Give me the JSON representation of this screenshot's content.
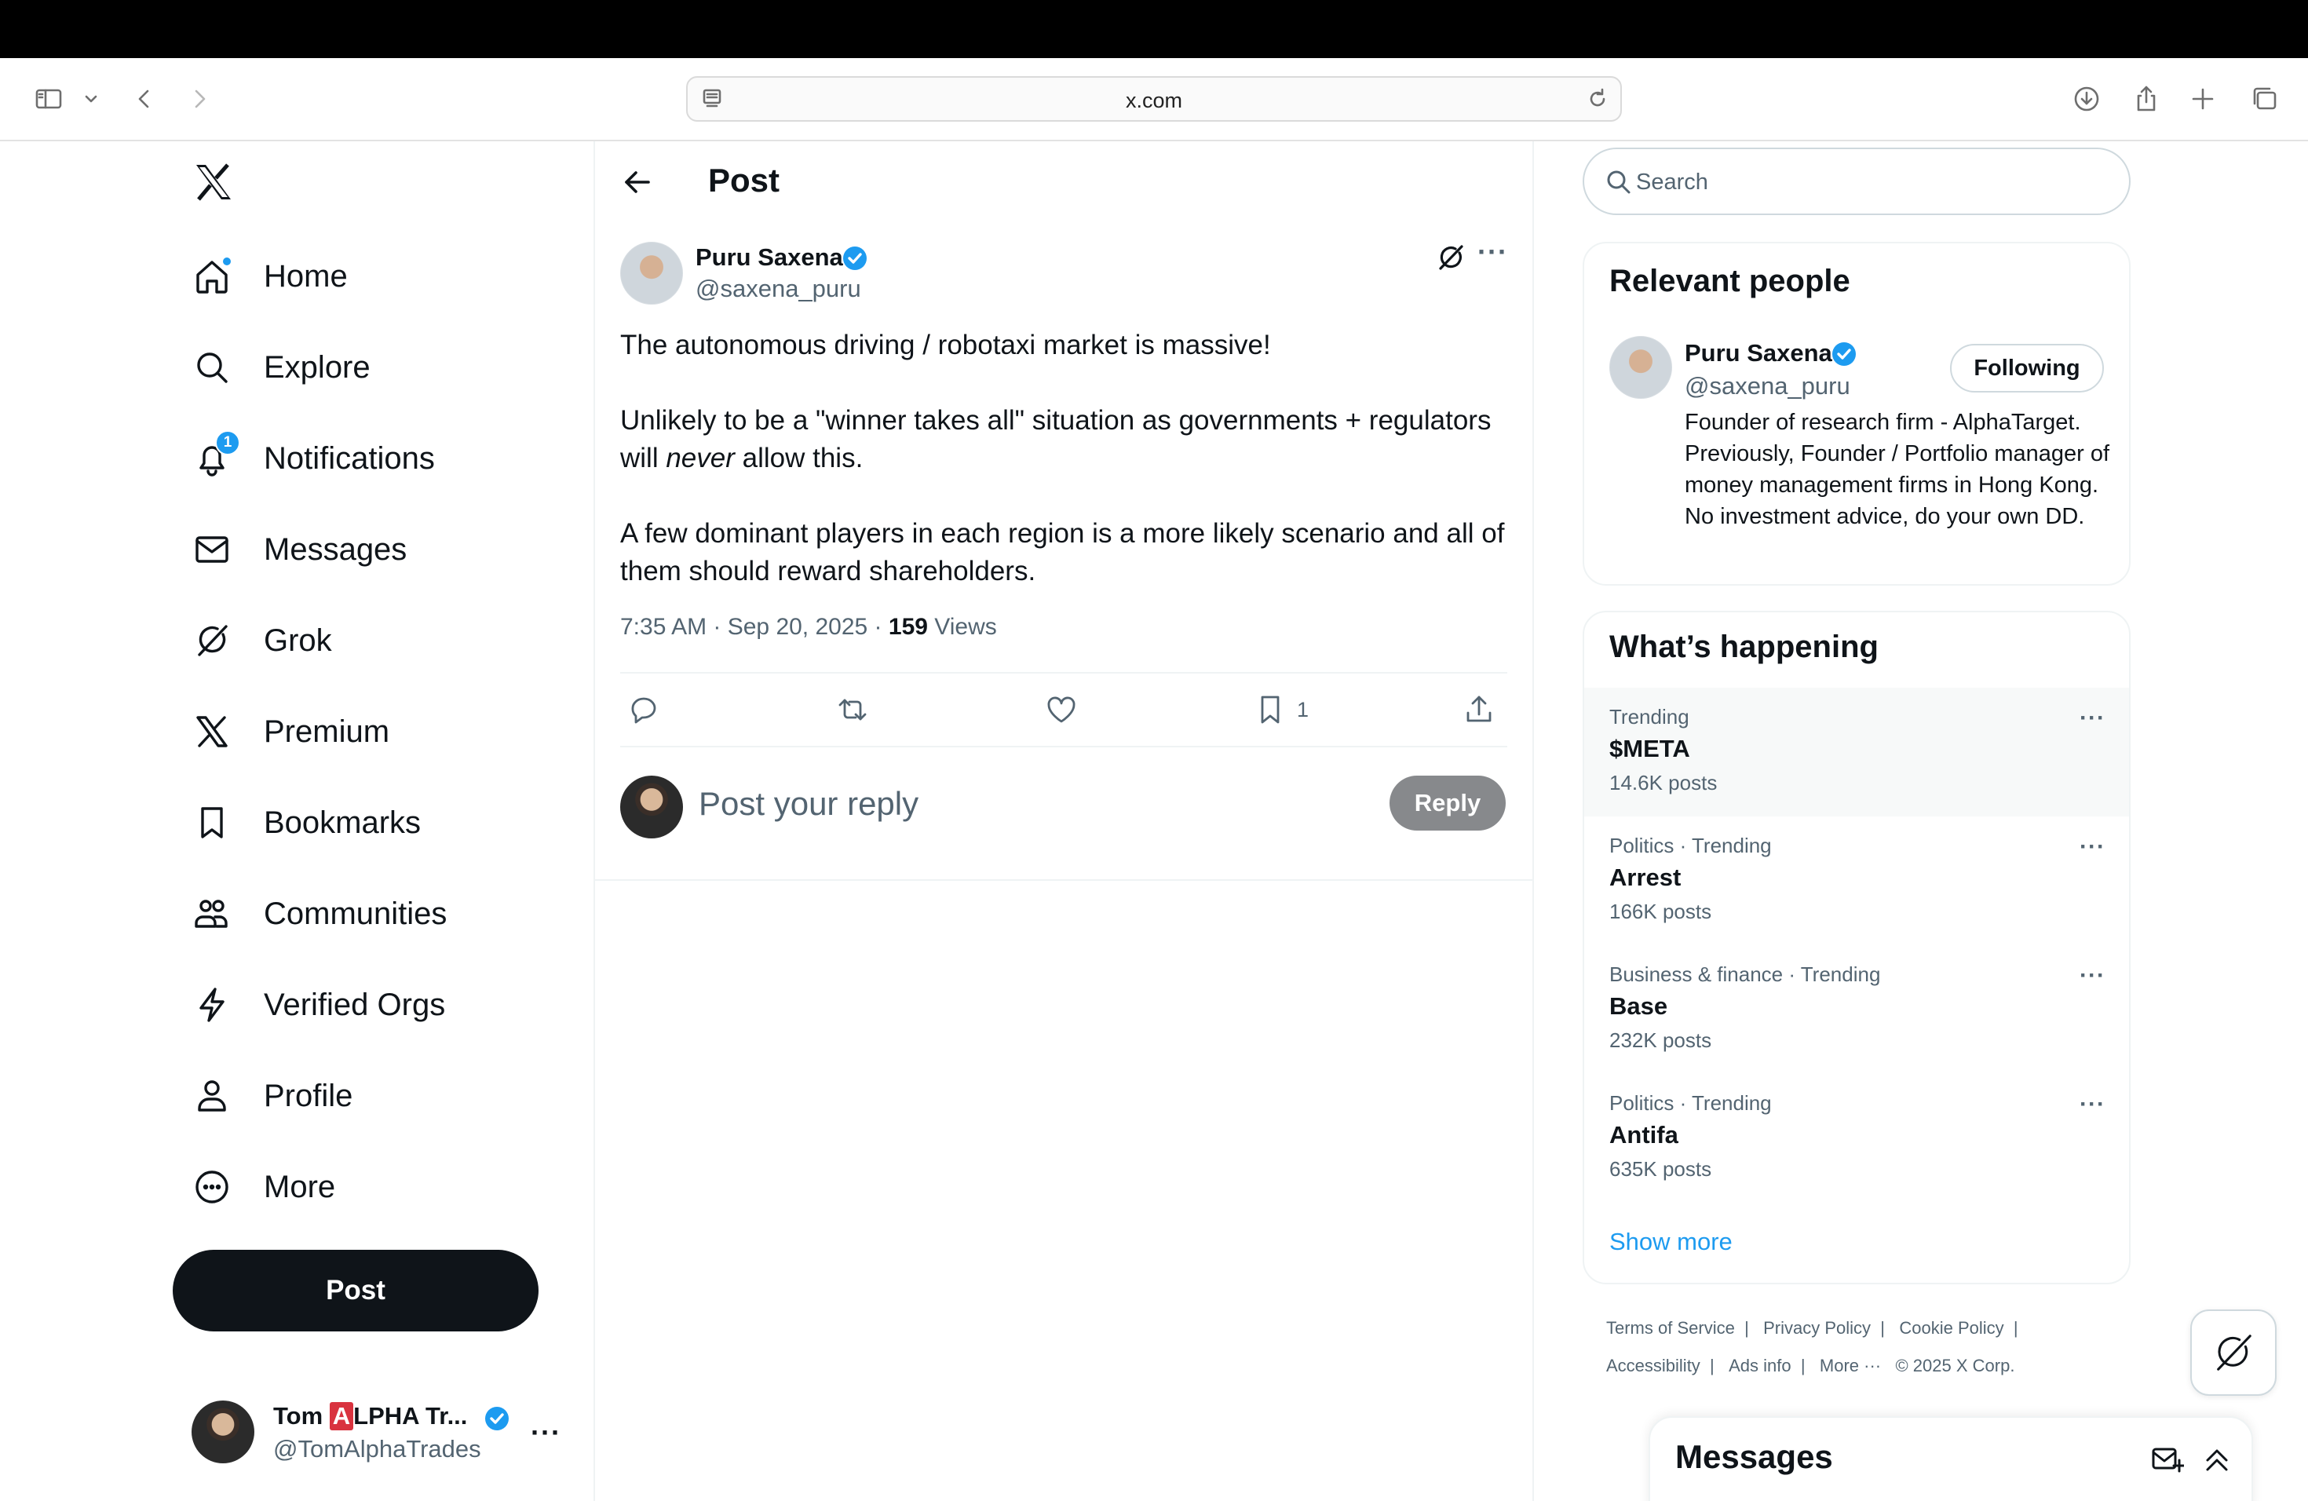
{
  "browser": {
    "url": "x.com",
    "icons": [
      "sidebar-icon",
      "chevron-down-icon",
      "back-icon",
      "forward-icon",
      "site-settings-icon",
      "reload-icon",
      "download-icon",
      "share-icon",
      "new-tab-icon",
      "tabs-overview-icon"
    ]
  },
  "nav": {
    "items": [
      {
        "label": "Home",
        "icon": "home-icon"
      },
      {
        "label": "Explore",
        "icon": "search-icon"
      },
      {
        "label": "Notifications",
        "icon": "bell-icon",
        "badge": "1"
      },
      {
        "label": "Messages",
        "icon": "mail-icon"
      },
      {
        "label": "Grok",
        "icon": "grok-icon"
      },
      {
        "label": "Premium",
        "icon": "x-icon"
      },
      {
        "label": "Bookmarks",
        "icon": "bookmark-icon"
      },
      {
        "label": "Communities",
        "icon": "communities-icon"
      },
      {
        "label": "Verified Orgs",
        "icon": "lightning-icon"
      },
      {
        "label": "Profile",
        "icon": "person-icon"
      },
      {
        "label": "More",
        "icon": "more-circle-icon"
      }
    ],
    "post_button": "Post",
    "account": {
      "name_prefix": "Tom ",
      "name_badge": "A",
      "name_suffix": "LPHA Tr...",
      "handle": "@TomAlphaTrades"
    }
  },
  "post": {
    "header_title": "Post",
    "author_name": "Puru Saxena",
    "author_handle": "@saxena_puru",
    "text_p1": "The autonomous driving / robotaxi market is massive!",
    "text_p2_a": "Unlikely to be a \"winner takes all\" situation as governments + regulators will ",
    "text_p2_em": "never",
    "text_p2_b": " allow this.",
    "text_p3": "A few dominant players in each region is a more likely scenario and all of them should reward shareholders.",
    "time": "7:35 AM · Sep 20, 2025 · ",
    "views_count": "159",
    "views_label": " Views",
    "bookmark_count": "1",
    "reply_placeholder": "Post your reply",
    "reply_button": "Reply"
  },
  "right": {
    "search_placeholder": "Search",
    "relevant_title": "Relevant people",
    "person": {
      "name": "Puru Saxena",
      "handle": "@saxena_puru",
      "follow_label": "Following",
      "bio": "Founder of research firm - AlphaTarget. Previously, Founder / Portfolio manager of money management firms in Hong Kong. No investment advice, do your own DD."
    },
    "happening_title": "What’s happening",
    "trends": [
      {
        "context": "Trending",
        "title": "$META",
        "count": "14.6K posts"
      },
      {
        "context": "Politics · Trending",
        "title": "Arrest",
        "count": "166K posts"
      },
      {
        "context": "Business & finance · Trending",
        "title": "Base",
        "count": "232K posts"
      },
      {
        "context": "Politics · Trending",
        "title": "Antifa",
        "count": "635K posts"
      }
    ],
    "show_more": "Show more",
    "footer": {
      "terms": "Terms of Service",
      "privacy": "Privacy Policy",
      "cookie": "Cookie Policy",
      "accessibility": "Accessibility",
      "ads": "Ads info",
      "more": "More ···",
      "copyright": "© 2025 X Corp.",
      "sep": "|"
    },
    "messages_title": "Messages"
  },
  "colors": {
    "accent": "#1d9bf0",
    "text": "#0f1419",
    "muted": "#536471",
    "reply_button_disabled": "#87898c",
    "badge_red": "#d9333f"
  }
}
